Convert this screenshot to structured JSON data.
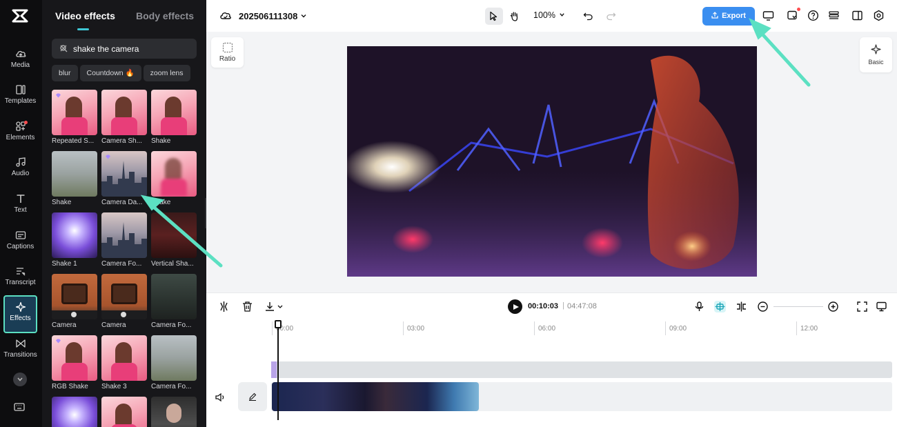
{
  "rail": {
    "items": [
      {
        "label": "Media",
        "icon": "cloud-upload-icon"
      },
      {
        "label": "Templates",
        "icon": "templates-icon"
      },
      {
        "label": "Elements",
        "icon": "elements-icon",
        "badge": true
      },
      {
        "label": "Audio",
        "icon": "music-note-icon"
      },
      {
        "label": "Text",
        "icon": "text-icon"
      },
      {
        "label": "Captions",
        "icon": "captions-icon"
      },
      {
        "label": "Transcript",
        "icon": "transcript-icon"
      },
      {
        "label": "Effects",
        "icon": "effects-icon",
        "active": true
      },
      {
        "label": "Transitions",
        "icon": "transitions-icon"
      }
    ]
  },
  "panel": {
    "tabs": [
      "Video effects",
      "Body effects"
    ],
    "active_tab": "Video effects",
    "search": {
      "value": "shake the camera"
    },
    "chips": [
      {
        "label": "blur"
      },
      {
        "label": "Countdown",
        "hot": true
      },
      {
        "label": "zoom lens"
      }
    ],
    "effects": [
      {
        "name": "Repeated S...",
        "style": "pink",
        "premium": true
      },
      {
        "name": "Camera Sh...",
        "style": "pink",
        "premium": false
      },
      {
        "name": "Shake",
        "style": "pink",
        "premium": false
      },
      {
        "name": "Shake",
        "style": "fog",
        "premium": false
      },
      {
        "name": "Camera Da...",
        "style": "city",
        "premium": true
      },
      {
        "name": "Shake",
        "style": "pink-blur",
        "premium": false
      },
      {
        "name": "Shake 1",
        "style": "purple",
        "premium": false
      },
      {
        "name": "Camera Fo...",
        "style": "city",
        "premium": false
      },
      {
        "name": "Vertical Sha...",
        "style": "red",
        "premium": false
      },
      {
        "name": "Camera",
        "style": "tv",
        "premium": false
      },
      {
        "name": "Camera",
        "style": "tv",
        "premium": false
      },
      {
        "name": "Camera Fo...",
        "style": "dark",
        "premium": false
      },
      {
        "name": "RGB Shake",
        "style": "pink",
        "premium": true
      },
      {
        "name": "Shake 3",
        "style": "pink",
        "premium": false
      },
      {
        "name": "Camera Fo...",
        "style": "fog",
        "premium": false
      },
      {
        "name": "",
        "style": "purple",
        "premium": false
      },
      {
        "name": "",
        "style": "pink",
        "premium": false
      },
      {
        "name": "",
        "style": "face",
        "premium": false
      }
    ]
  },
  "topbar": {
    "project_name": "202506111308",
    "zoom": "100%",
    "export_label": "Export"
  },
  "stage": {
    "ratio_label": "Ratio",
    "basic_label": "Basic"
  },
  "player": {
    "current_time": "00:10:03",
    "separator": "|",
    "duration": "04:47:08"
  },
  "timeline": {
    "ticks": [
      "00:00",
      "03:00",
      "06:00",
      "09:00",
      "12:00"
    ]
  },
  "colors": {
    "accent": "#3a8ef0",
    "annotation_arrow": "#5ce0c2",
    "active_rail_border": "#5ce0c2",
    "tab_indicator": "#3fc8d6"
  }
}
